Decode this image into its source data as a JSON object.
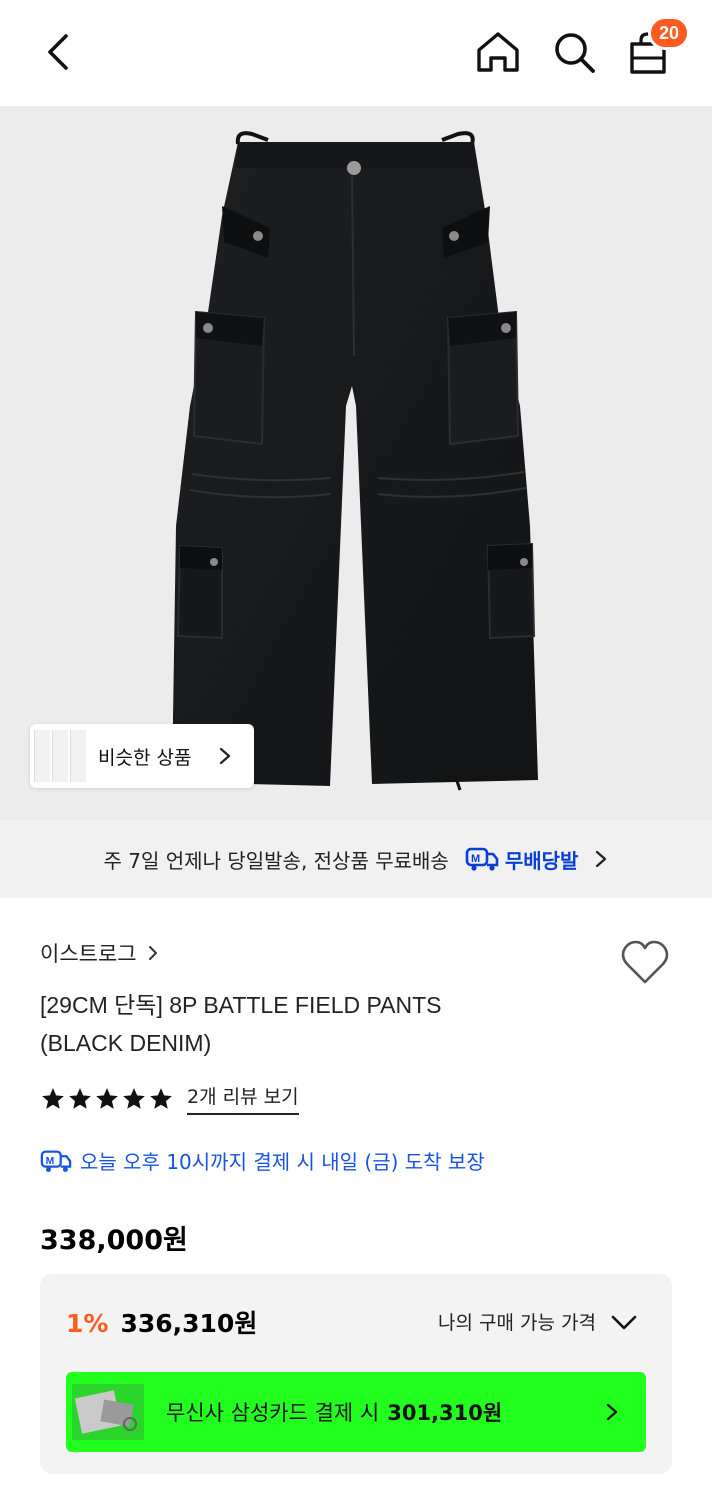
{
  "header": {
    "cart_count": "20",
    "icons": [
      "back-icon",
      "home-icon",
      "search-icon",
      "shopping-bag-icon"
    ]
  },
  "gallery": {
    "similar_label": "비슷한 상품"
  },
  "shipping_banner": {
    "text": "주 7일 언제나 당일발송, 전상품 무료배송",
    "brand": "무배당발",
    "accent": "#0a3fd6"
  },
  "product": {
    "brand": "이스트로그",
    "title_line1": "[29CM 단독] 8P BATTLE FIELD PANTS",
    "title_line2": "(BLACK DENIM)",
    "rating_stars": 5,
    "review_link": "2개 리뷰 보기",
    "delivery_promise": "오늘 오후 10시까지 결제 시 내일 (금) 도착 보장",
    "price": "338,000원"
  },
  "price_box": {
    "discount_rate": "1%",
    "discount_price": "336,310원",
    "my_price_label": "나의 구매 가능 가격",
    "card_offer_text": "무신사 삼성카드 결제 시",
    "card_offer_price": "301,310원"
  },
  "colors": {
    "badge": "#ff5a1f",
    "delivery": "#1753e4",
    "card_banner": "#22ff1f",
    "discount": "#ff5a1f"
  }
}
